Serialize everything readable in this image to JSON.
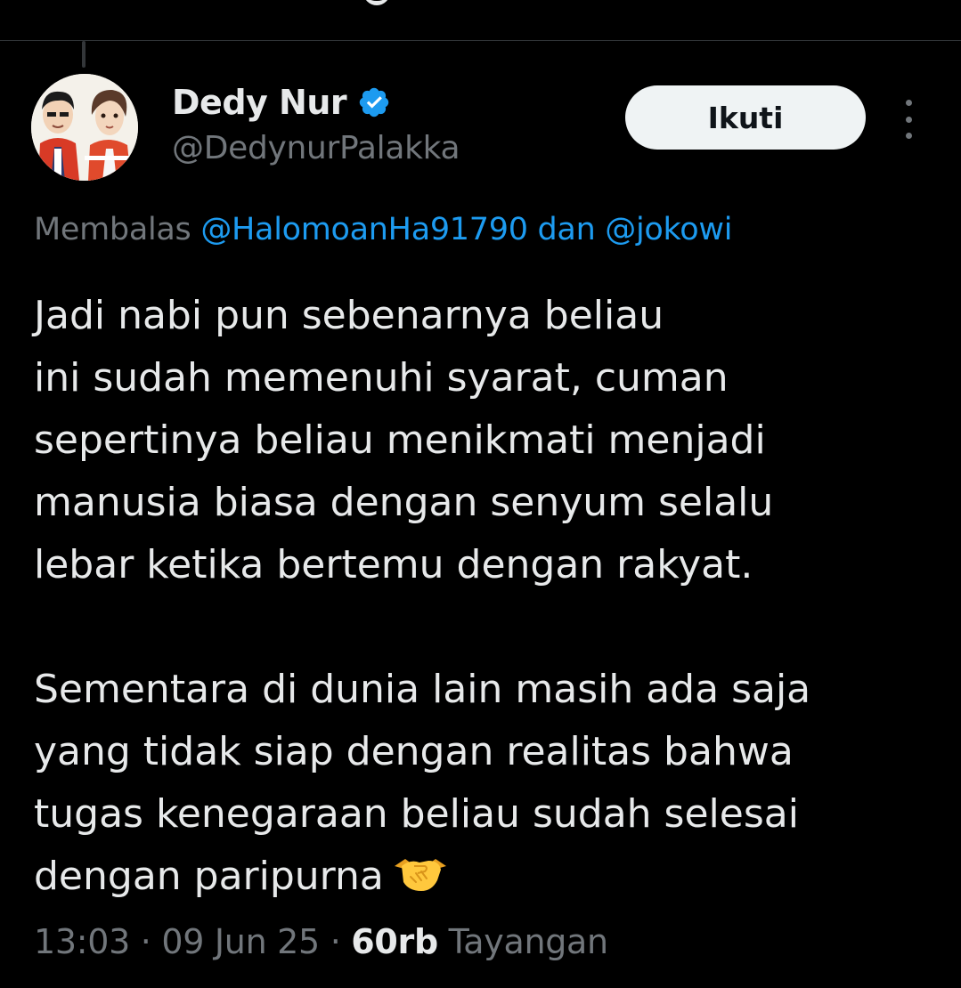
{
  "author": {
    "display_name": "Dedy Nur",
    "handle": "@DedynurPalakka",
    "verified": true,
    "avatar": "avatar-image"
  },
  "follow_button": {
    "label": "Ikuti"
  },
  "reply": {
    "prefix": "Membalas",
    "mention1": "@HalomoanHa91790",
    "joiner": "dan",
    "mention2": "@jokowi"
  },
  "tweet": {
    "paragraph1": [
      "Jadi nabi pun sebenarnya beliau",
      "ini sudah memenuhi syarat, cuman",
      "sepertinya beliau menikmati menjadi",
      "manusia biasa dengan senyum selalu",
      "lebar ketika bertemu dengan rakyat."
    ],
    "paragraph2": [
      "Sementara di dunia lain masih ada saja",
      "yang tidak siap dengan realitas bahwa",
      "tugas kenegaraan beliau sudah selesai",
      "dengan paripurna"
    ],
    "emoji": "handshake-icon"
  },
  "meta": {
    "time": "13:03",
    "separator": "·",
    "date": "09 Jun 25",
    "views_count": "60rb",
    "views_label": "Tayangan"
  },
  "colors": {
    "background": "#000000",
    "text": "#e7e9ea",
    "secondary_text": "#71767b",
    "link": "#1d9bf0",
    "verified_badge": "#1d9bf0",
    "button_bg": "#eff3f4",
    "divider": "#2f3336"
  }
}
